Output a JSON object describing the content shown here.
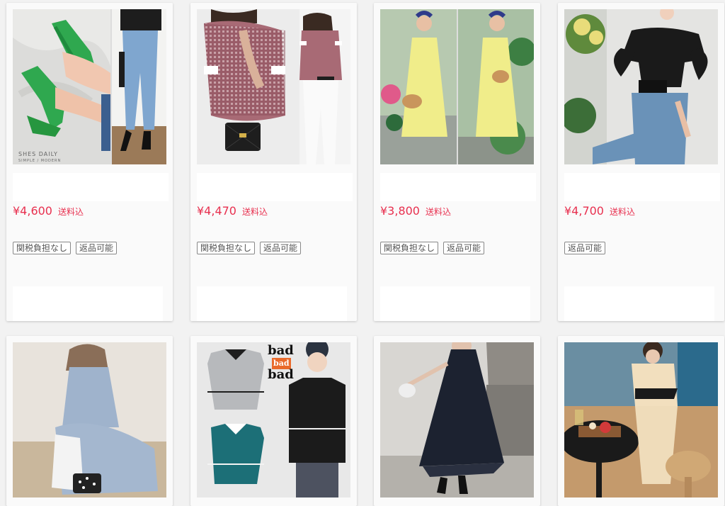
{
  "products": [
    {
      "price": "¥4,600",
      "shipping": "送料込",
      "tags": [
        "関税負担なし",
        "返品可能"
      ]
    },
    {
      "price": "¥4,470",
      "shipping": "送料込",
      "tags": [
        "関税負担なし",
        "返品可能"
      ]
    },
    {
      "price": "¥3,800",
      "shipping": "送料込",
      "tags": [
        "関税負担なし",
        "返品可能"
      ]
    },
    {
      "price": "¥4,700",
      "shipping": "送料込",
      "tags": [
        "返品可能"
      ]
    }
  ],
  "image_text": {
    "shes_daily": "SHES DAILY",
    "shes_daily_sub": "SIMPLE / MODERN",
    "bad1": "bad",
    "bad2": "bad",
    "bad3": "bad"
  }
}
